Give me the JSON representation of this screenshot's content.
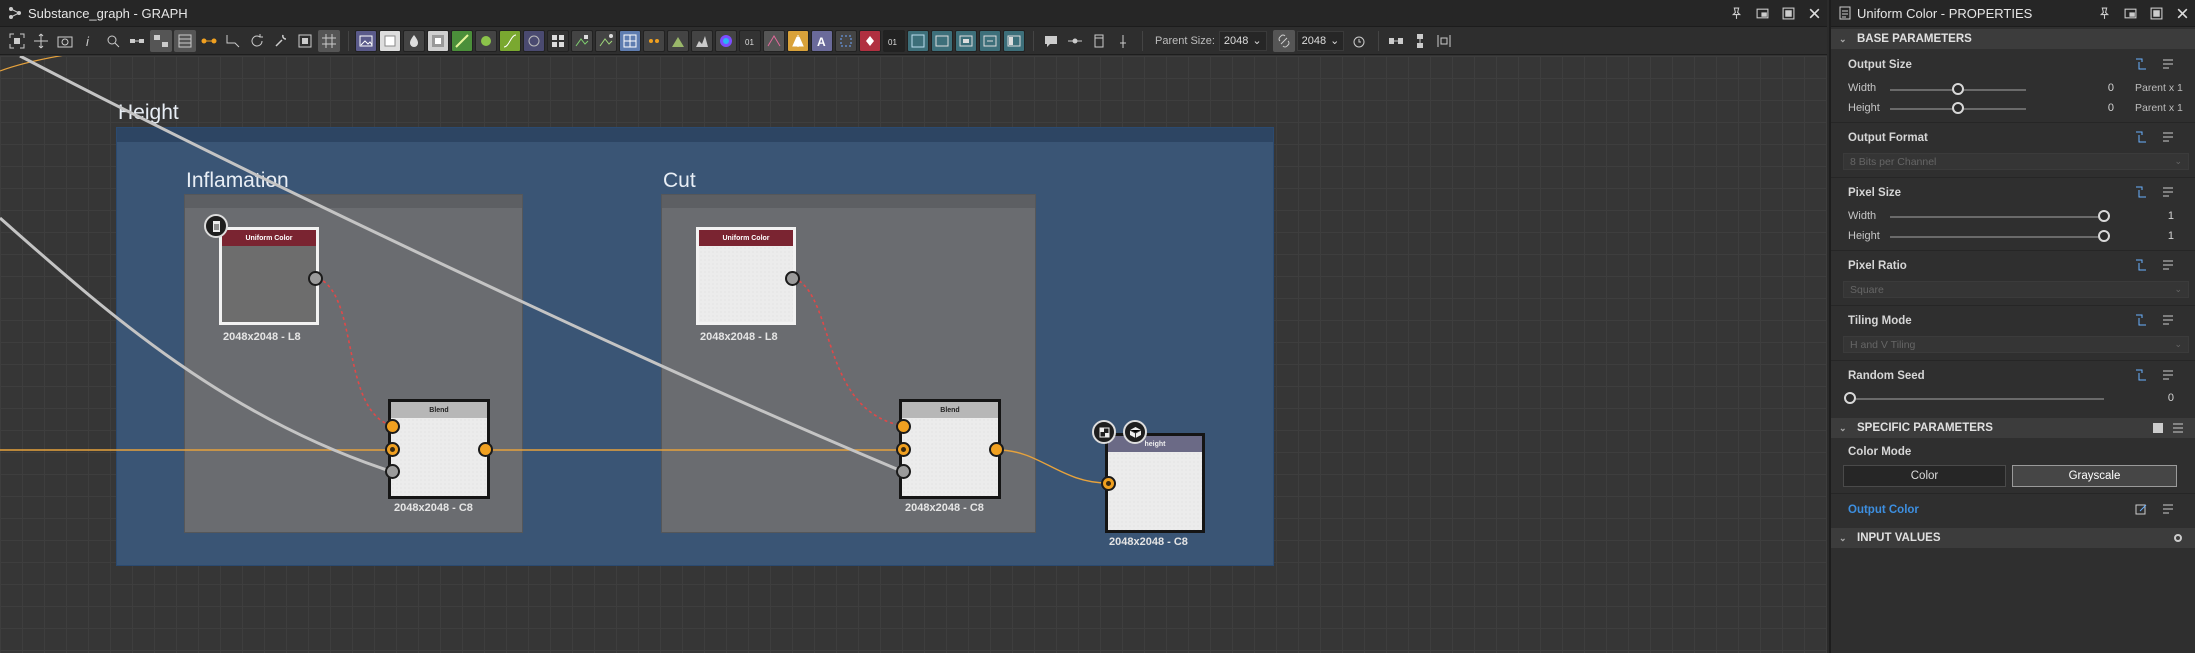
{
  "graph": {
    "title": "Substance_graph - GRAPH",
    "toolbar": {
      "parent_size_label": "Parent Size:",
      "parent_size_value": "2048",
      "linked_size_value": "2048"
    },
    "frames": {
      "outer_title": "Height",
      "left_title": "Inflamation",
      "right_title": "Cut"
    },
    "nodes": {
      "uniform_color_1": {
        "header": "Uniform Color",
        "caption": "2048x2048 - L8"
      },
      "uniform_color_2": {
        "header": "Uniform Color",
        "caption": "2048x2048 - L8"
      },
      "blend_1": {
        "header": "Blend",
        "caption": "2048x2048 - C8"
      },
      "blend_2": {
        "header": "Blend",
        "caption": "2048x2048 - C8"
      },
      "height_output": {
        "header": "height",
        "caption": "2048x2048 - C8"
      }
    }
  },
  "properties": {
    "title": "Uniform Color - PROPERTIES",
    "base_section": "BASE PARAMETERS",
    "output_size": {
      "label": "Output Size",
      "width_label": "Width",
      "width_value": "0",
      "width_note": "Parent x 1",
      "height_label": "Height",
      "height_value": "0",
      "height_note": "Parent x 1"
    },
    "output_format": {
      "label": "Output Format",
      "value": "8 Bits per Channel"
    },
    "pixel_size": {
      "label": "Pixel Size",
      "width_label": "Width",
      "width_value": "1",
      "height_label": "Height",
      "height_value": "1"
    },
    "pixel_ratio": {
      "label": "Pixel Ratio",
      "value": "Square"
    },
    "tiling_mode": {
      "label": "Tiling Mode",
      "value": "H and V Tiling"
    },
    "random_seed": {
      "label": "Random Seed",
      "value": "0"
    },
    "specific_section": "SPECIFIC PARAMETERS",
    "color_mode": {
      "label": "Color Mode",
      "option_color": "Color",
      "option_grayscale": "Grayscale",
      "selected": "Grayscale"
    },
    "output_color": {
      "label": "Output Color",
      "label_color": "#3d8fe0"
    },
    "input_section": "INPUT VALUES"
  },
  "colors": {
    "frame_blue": "#3a5575",
    "node_header_red": "#7a2431",
    "port_orange": "#f0a020",
    "link_orange": "#e6a23c",
    "link_red_dashed": "#e04848"
  }
}
